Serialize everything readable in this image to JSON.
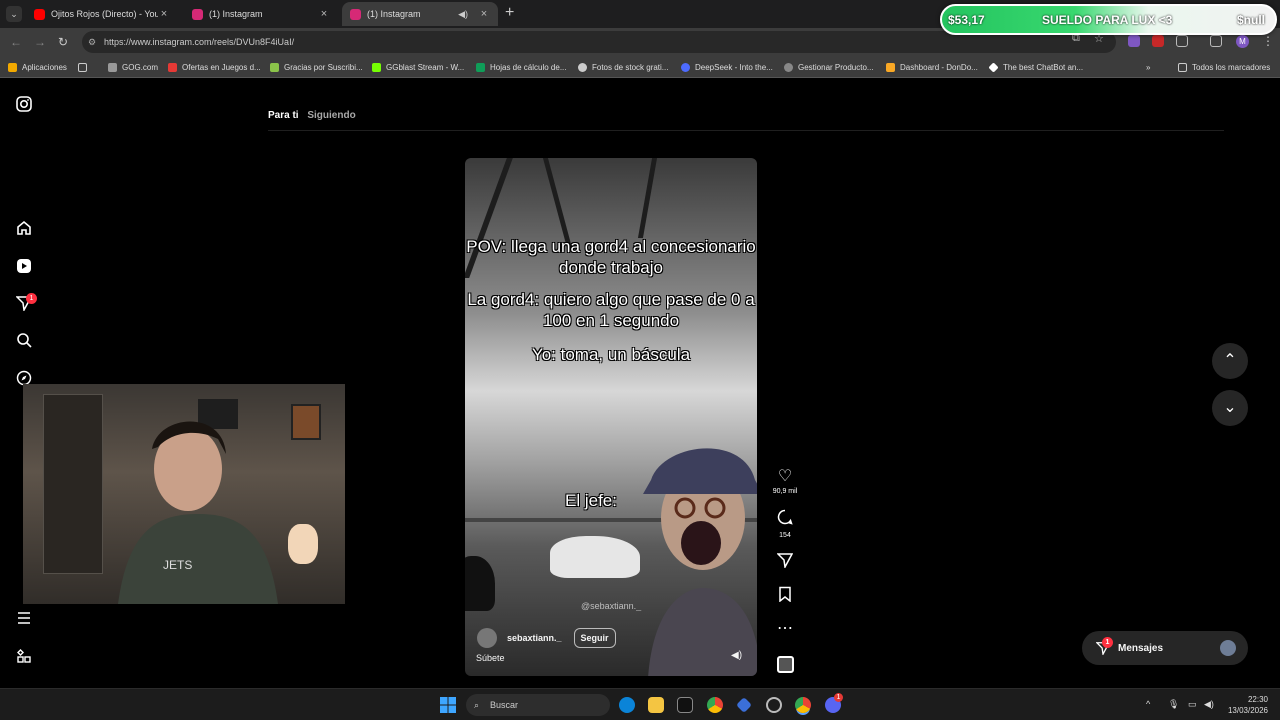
{
  "browser": {
    "tabs": [
      {
        "title": "Ojitos Rojos (Directo) - YouTube",
        "icon": "youtube-icon",
        "color": "#ff0000"
      },
      {
        "title": "(1) Instagram",
        "icon": "instagram-icon",
        "color": "#d62976"
      },
      {
        "title": "(1) Instagram",
        "icon": "instagram-icon",
        "color": "#d62976",
        "active": true
      }
    ],
    "url": "https://www.instagram.com/reels/DVUn8F4iUaI/",
    "bookmarks": [
      "Aplicaciones",
      "GOG.com",
      "Ofertas en Juegos d...",
      "Gracias por Suscribi...",
      "GGblast Stream - W...",
      "Hojas de cálculo de...",
      "Fotos de stock grati...",
      "DeepSeek - Into the...",
      "Gestionar Producto...",
      "Dashboard - DonDo...",
      "The best ChatBot an..."
    ],
    "bookmarks_all": "Todos los marcadores",
    "profile_initial": "M"
  },
  "donation": {
    "amount": "$53,17",
    "message": "SUELDO PARA LUX <3",
    "user": "$null"
  },
  "instagram": {
    "tabs": [
      "Para ti",
      "Siguiendo"
    ],
    "notifications_badge": "1",
    "reel": {
      "caption_lines": [
        "POV: llega una gord4 al concesionario donde trabajo",
        "La gord4: quiero algo que pase de 0 a 100 en 1 segundo",
        "Yo: toma, un báscula"
      ],
      "overlay_text": "El jefe:",
      "watermark": "@sebaxtiann._",
      "author": "sebaxtiann._",
      "follow_label": "Seguir",
      "audio_text": "Súbete"
    },
    "actions": {
      "likes": "90,9 mil",
      "comments": "154"
    },
    "messages_label": "Mensajes",
    "messages_badge": "1"
  },
  "taskbar": {
    "search_placeholder": "Buscar",
    "time": "22:30",
    "date": "13/03/2026",
    "badge": "1"
  }
}
